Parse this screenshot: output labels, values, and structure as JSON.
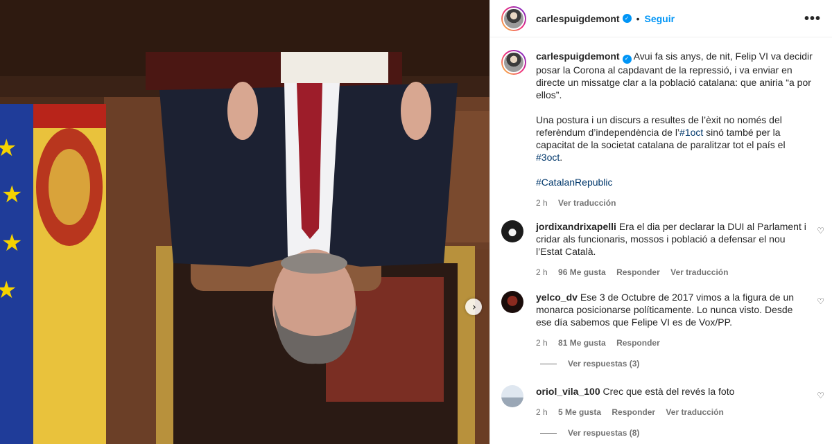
{
  "post": {
    "author": "carlespuigdemont",
    "follow_label": "Seguir",
    "separator": "•",
    "more_label": "•••",
    "caption_p1": "Avui fa sis anys, de nit, Felip VI va decidir posar la Corona al capdavant de la repressió, i va enviar en directe un missatge clar a la població catalana: que aniria “a por ellos”.",
    "caption_p2_a": "Una postura i un discurs a resultes de l’èxit no només del referèndum d’independència de l’",
    "caption_tag1": "#1oct",
    "caption_p2_b": " sinó també per la capacitat de la societat catalana de paralitzar tot el país el ",
    "caption_tag2": "#3oct",
    "caption_p2_c": ".",
    "caption_tag3": "#CatalanRepublic",
    "time": "2 h",
    "translate": "Ver traducción"
  },
  "comments": [
    {
      "user": "jordixandrixapelli",
      "text": "Era el dia per declarar la DUI al Parlament i cridar als funcionaris, mossos i població a defensar el nou l’Estat Català.",
      "time": "2 h",
      "likes": "96 Me gusta",
      "reply": "Responder",
      "translate": "Ver traducción"
    },
    {
      "user": "yelco_dv",
      "text": "Ese 3 de Octubre de 2017 vimos a la figura de un monarca posicionarse políticamente. Lo nunca visto. Desde ese día sabemos que Felipe VI es de Vox/PP.",
      "time": "2 h",
      "likes": "81 Me gusta",
      "reply": "Responder",
      "view_replies": "Ver respuestas (3)"
    },
    {
      "user": "oriol_vila_100",
      "text": "Crec que està del revés la foto",
      "time": "2 h",
      "likes": "5 Me gusta",
      "reply": "Responder",
      "translate": "Ver traducción",
      "view_replies": "Ver respuestas (8)"
    }
  ],
  "icons": {
    "heart": "♡",
    "next": "›",
    "verified": "✓"
  },
  "colors": {
    "link": "#0095f6",
    "hashtag": "#00376b",
    "muted": "#737373"
  }
}
